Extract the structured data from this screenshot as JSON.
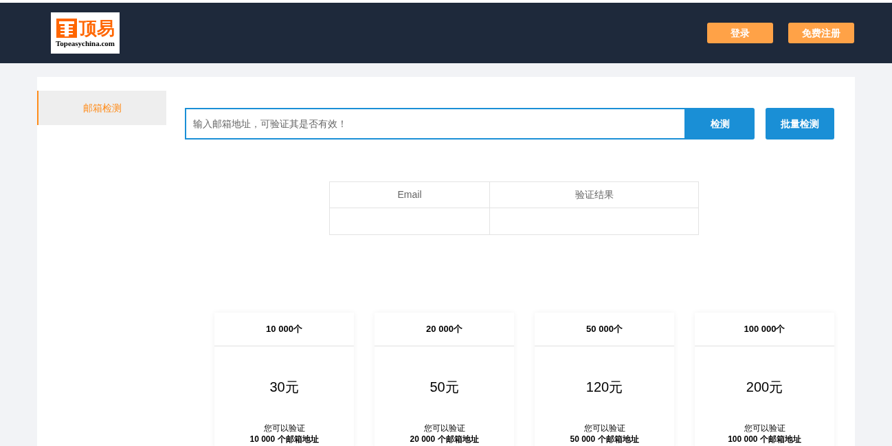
{
  "header": {
    "logo": {
      "name": "顶易",
      "domain": "Topeasychina.com"
    },
    "buttons": [
      "登录",
      "免费注册"
    ]
  },
  "sidebar": {
    "items": [
      {
        "label": "邮箱检测",
        "selected": true
      }
    ]
  },
  "search": {
    "placeholder": "输入邮箱地址，可验证其是否有效！",
    "button": "检测",
    "batch_button": "批量检测"
  },
  "table": {
    "columns": [
      "Email",
      "验证结果"
    ]
  },
  "plans": [
    {
      "count": "10 000个",
      "price": "30元",
      "line1": "您可以验证",
      "line2": "10 000 个邮箱地址"
    },
    {
      "count": "20 000个",
      "price": "50元",
      "line1": "您可以验证",
      "line2": "20 000 个邮箱地址"
    },
    {
      "count": "50 000个",
      "price": "120元",
      "line1": "您可以验证",
      "line2": "50 000 个邮箱地址"
    },
    {
      "count": "100 000个",
      "price": "200元",
      "line1": "您可以验证",
      "line2": "100 000 个邮箱地址"
    }
  ]
}
